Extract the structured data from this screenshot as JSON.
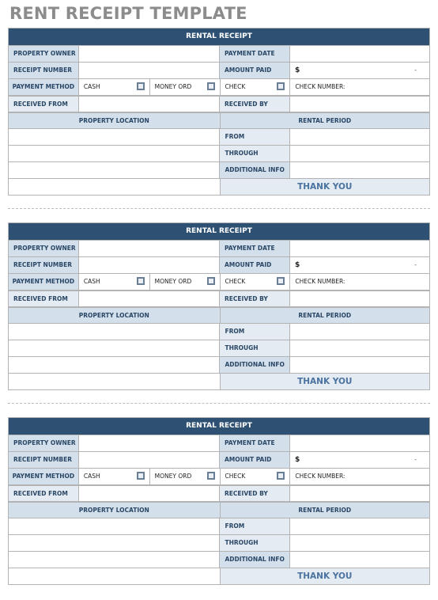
{
  "page_title": "RENT RECEIPT TEMPLATE",
  "receipts": [
    {
      "header": "RENTAL RECEIPT",
      "property_owner_label": "PROPERTY OWNER",
      "property_owner_value": "",
      "payment_date_label": "PAYMENT DATE",
      "payment_date_value": "",
      "receipt_number_label": "RECEIPT NUMBER",
      "receipt_number_value": "",
      "amount_paid_label": "AMOUNT PAID",
      "amount_currency": "$",
      "amount_value": "-",
      "payment_method_label": "PAYMENT METHOD",
      "cash_label": "CASH",
      "money_order_label": "MONEY ORD",
      "check_label": "CHECK",
      "check_number_label": "CHECK NUMBER:",
      "received_from_label": "RECEIVED FROM",
      "received_from_value": "",
      "received_by_label": "RECEIVED BY",
      "received_by_value": "",
      "property_location_label": "PROPERTY LOCATION",
      "rental_period_label": "RENTAL PERIOD",
      "from_label": "FROM",
      "through_label": "THROUGH",
      "additional_info_label": "ADDITIONAL INFO",
      "thank_you": "THANK YOU"
    },
    {
      "header": "RENTAL RECEIPT",
      "property_owner_label": "PROPERTY OWNER",
      "property_owner_value": "",
      "payment_date_label": "PAYMENT DATE",
      "payment_date_value": "",
      "receipt_number_label": "RECEIPT NUMBER",
      "receipt_number_value": "",
      "amount_paid_label": "AMOUNT PAID",
      "amount_currency": "$",
      "amount_value": "-",
      "payment_method_label": "PAYMENT METHOD",
      "cash_label": "CASH",
      "money_order_label": "MONEY ORD",
      "check_label": "CHECK",
      "check_number_label": "CHECK NUMBER:",
      "received_from_label": "RECEIVED FROM",
      "received_from_value": "",
      "received_by_label": "RECEIVED BY",
      "received_by_value": "",
      "property_location_label": "PROPERTY LOCATION",
      "rental_period_label": "RENTAL PERIOD",
      "from_label": "FROM",
      "through_label": "THROUGH",
      "additional_info_label": "ADDITIONAL INFO",
      "thank_you": "THANK YOU"
    },
    {
      "header": "RENTAL RECEIPT",
      "property_owner_label": "PROPERTY OWNER",
      "property_owner_value": "",
      "payment_date_label": "PAYMENT DATE",
      "payment_date_value": "",
      "receipt_number_label": "RECEIPT NUMBER",
      "receipt_number_value": "",
      "amount_paid_label": "AMOUNT PAID",
      "amount_currency": "$",
      "amount_value": "-",
      "payment_method_label": "PAYMENT METHOD",
      "cash_label": "CASH",
      "money_order_label": "MONEY ORD",
      "check_label": "CHECK",
      "check_number_label": "CHECK NUMBER:",
      "received_from_label": "RECEIVED FROM",
      "received_from_value": "",
      "received_by_label": "RECEIVED BY",
      "received_by_value": "",
      "property_location_label": "PROPERTY LOCATION",
      "rental_period_label": "RENTAL PERIOD",
      "from_label": "FROM",
      "through_label": "THROUGH",
      "additional_info_label": "ADDITIONAL INFO",
      "thank_you": "THANK YOU"
    }
  ],
  "colors": {
    "header_bg": "#2d5073",
    "label_bg": "#d3e0ec",
    "thank_you_text": "#4b73a0",
    "title_text": "#8c8c8c"
  }
}
